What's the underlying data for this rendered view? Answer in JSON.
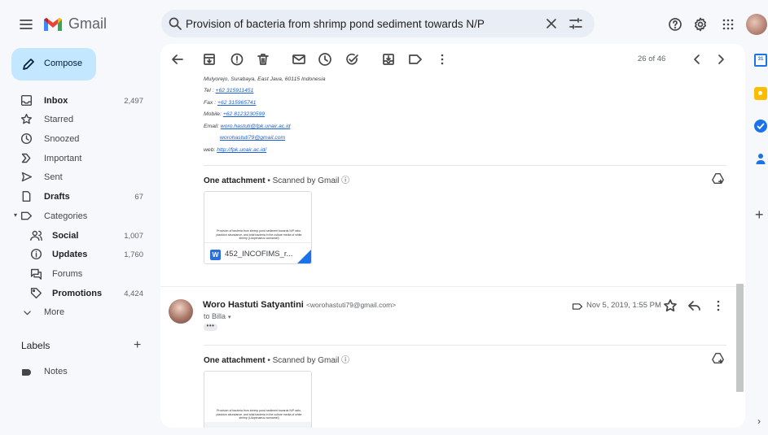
{
  "app": {
    "name": "Gmail"
  },
  "search": {
    "value": "Provision of bacteria from shrimp pond sediment towards N/P"
  },
  "compose": {
    "label": "Compose"
  },
  "nav": {
    "inbox": {
      "label": "Inbox",
      "count": "2,497"
    },
    "starred": {
      "label": "Starred"
    },
    "snoozed": {
      "label": "Snoozed"
    },
    "important": {
      "label": "Important"
    },
    "sent": {
      "label": "Sent"
    },
    "drafts": {
      "label": "Drafts",
      "count": "67"
    },
    "categories": {
      "label": "Categories"
    },
    "social": {
      "label": "Social",
      "count": "1,007"
    },
    "updates": {
      "label": "Updates",
      "count": "1,760"
    },
    "forums": {
      "label": "Forums"
    },
    "promotions": {
      "label": "Promotions",
      "count": "4,424"
    },
    "more": {
      "label": "More"
    }
  },
  "labels": {
    "title": "Labels",
    "items": [
      {
        "label": "Notes"
      }
    ]
  },
  "pager": {
    "text": "26 of 46"
  },
  "signature": {
    "address": "Mulyorejo, Surabaya, East Java, 60115 Indonesia",
    "tel_label": "Tel :",
    "tel": "+62 315911451",
    "fax_label": "Fax :",
    "fax": "+62 315965741",
    "mobile_label": "Mobile:",
    "mobile": "+62 8123230599",
    "email_label": "Email:",
    "email1": "woro.hastuti@fpk.unair.ac.id",
    "email2": "worohastuti79@gmail.com",
    "web_label": "web:",
    "web": "http://fpk.unair.ac.id/"
  },
  "attachment_section": {
    "title": "One attachment",
    "bullet": " • ",
    "scan": "Scanned by Gmail",
    "info_glyph": "ⓘ"
  },
  "attachment": {
    "filename": "452_INCOFIMS_r...",
    "file_type_glyph": "W",
    "preview_text": "Provision of bacteria from shrimp pond sediment towards N/P ratio, plankton abundance, and total bacteria in the culture media of white shrimp (Litopenaeus vannamei)"
  },
  "message": {
    "sender_name": "Woro Hastuti Satyantini",
    "sender_email": "<worohastuti79@gmail.com>",
    "recipient": "to Billa",
    "recipient_caret": "▾",
    "date": "Nov 5, 2019, 1:55 PM",
    "ellipsis": "•••"
  },
  "rail": {
    "calendar_glyph": "31",
    "add_glyph": "+",
    "expand_glyph": "›"
  },
  "colors": {
    "accent": "#1a73e8",
    "compose_bg": "#c2e7ff",
    "background": "#f6f8fc"
  }
}
